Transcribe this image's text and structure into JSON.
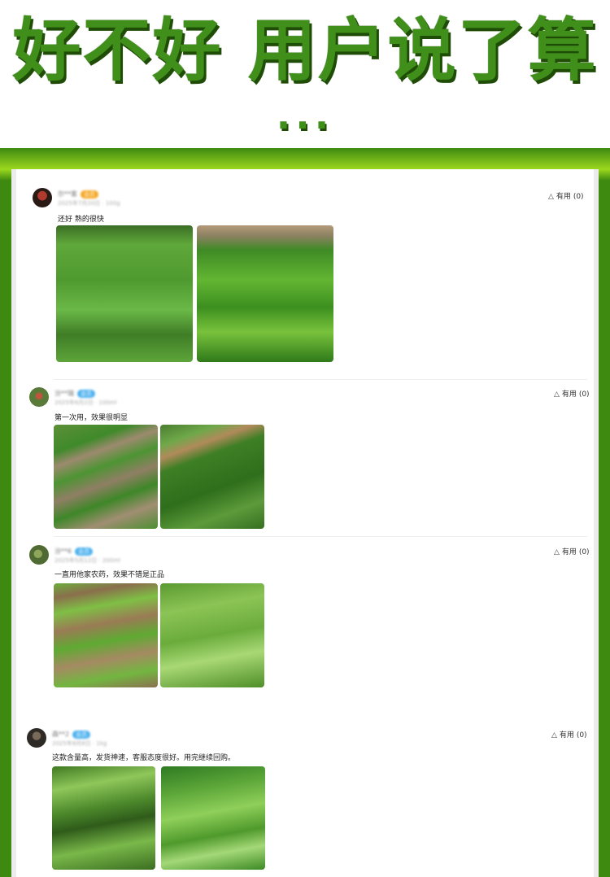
{
  "hero": {
    "title": "好不好 用户说了算",
    "dots": "..."
  },
  "useful_label": "有用",
  "reviews": [
    {
      "user": "尔**客",
      "badge": "会员",
      "meta": "2025年7月20日 · 100g",
      "useful_count": "(0)",
      "text": "还好 熟的很快",
      "photo_names": [
        "seedling-field-photo",
        "leafy-greens-photo"
      ]
    },
    {
      "user": "汾**瑞",
      "badge": "会员",
      "meta": "2025年6月2日 · 100ml",
      "useful_count": "(0)",
      "text": "第一次用，效果很明显",
      "photo_names": [
        "seedling-rows-photo",
        "spinach-rows-photo"
      ]
    },
    {
      "user": "汾**6",
      "badge": "会员",
      "meta": "2025年5月12日 · 200ml",
      "useful_count": "(0)",
      "text": "一直用他家农药，效果不错是正品",
      "photo_names": [
        "seedling-soil-photo",
        "dense-greens-photo"
      ]
    },
    {
      "user": "森**2",
      "badge": "会员",
      "meta": "2025年8月8日 · 1kg",
      "useful_count": "(0)",
      "text": "这款含量高，发货神速，客服态度很好。用完继续回购。",
      "photo_names": [
        "young-greens-photo",
        "round-leaves-photo"
      ]
    }
  ],
  "colors": {
    "brand_green": "#3f8f1a",
    "frame_dark": "#3e8a10",
    "frame_light": "#9bd81e",
    "badge_orange": "#f5a623",
    "badge_blue": "#4ab0ee"
  }
}
